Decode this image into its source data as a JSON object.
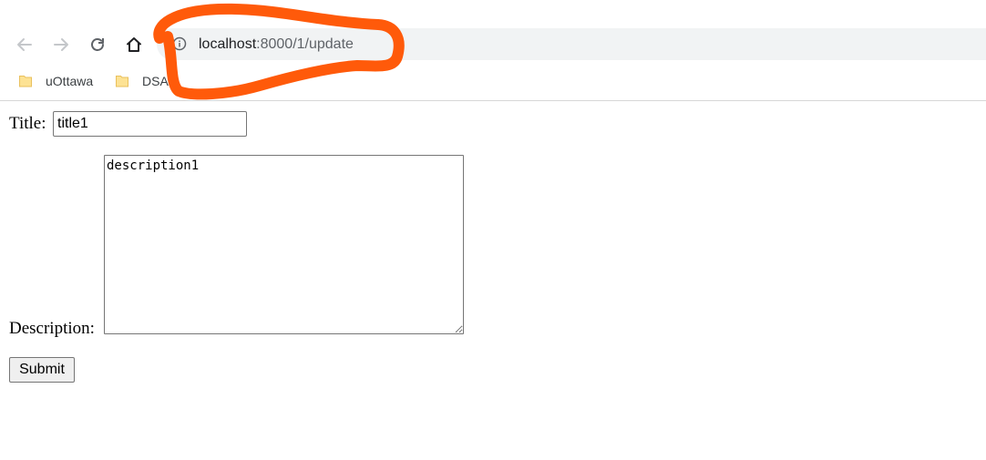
{
  "browser": {
    "address_host": "localhost",
    "address_rest": ":8000/1/update",
    "bookmarks": [
      {
        "label": "uOttawa"
      },
      {
        "label": "DSA"
      }
    ]
  },
  "form": {
    "title_label": "Title:",
    "title_value": "title1",
    "description_label": "Description:",
    "description_value": "description1",
    "submit_label": "Submit"
  },
  "colors": {
    "annotation": "#ff5a0a",
    "omnibox_bg": "#f1f3f4",
    "folder": "#fde293"
  }
}
